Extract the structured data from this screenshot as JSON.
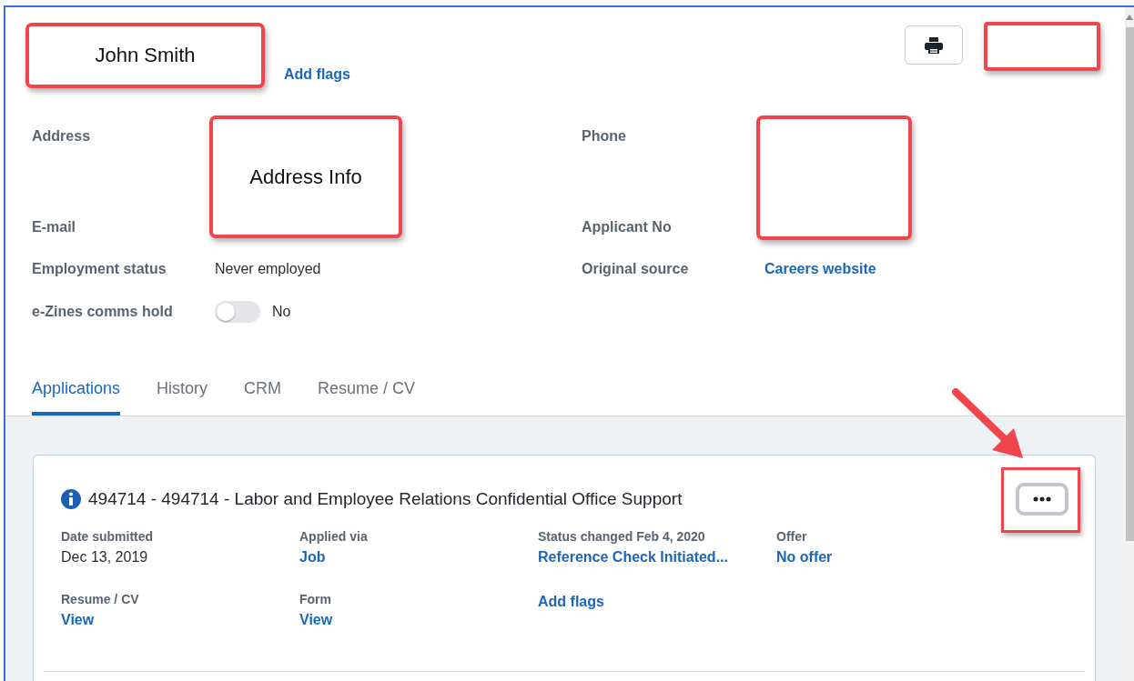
{
  "header": {
    "name": "John Smith",
    "add_flags": "Add flags"
  },
  "contact": {
    "address": {
      "label": "Address",
      "value": "Address Info"
    },
    "email": {
      "label": "E-mail"
    },
    "employment_status": {
      "label": "Employment status",
      "value": "Never employed"
    },
    "zines_hold": {
      "label": "e-Zines comms hold",
      "on": false,
      "value": "No"
    },
    "phone": {
      "label": "Phone"
    },
    "applicant_no": {
      "label": "Applicant No"
    },
    "original_source": {
      "label": "Original source",
      "value": "Careers website"
    }
  },
  "tabs": [
    {
      "label": "Applications",
      "selected": true
    },
    {
      "label": "History",
      "selected": false
    },
    {
      "label": "CRM",
      "selected": false
    },
    {
      "label": "Resume / CV",
      "selected": false
    }
  ],
  "application": {
    "title": "494714 - 494714 - Labor and Employee Relations Confidential Office Support",
    "menu_highlighted": true,
    "fields": [
      {
        "label": "Date submitted",
        "value": "Dec 13, 2019",
        "kind": "text"
      },
      {
        "label": "Applied via",
        "value": "Job",
        "kind": "link"
      },
      {
        "label": "Status changed Feb 4, 2020",
        "value": "Reference Check Initiated...",
        "kind": "link"
      },
      {
        "label": "Offer",
        "value": "No offer",
        "kind": "link"
      },
      {
        "label": "Resume / CV",
        "value": "View",
        "kind": "link"
      },
      {
        "label": "Form",
        "value": "View",
        "kind": "link"
      },
      {
        "value": "Add flags",
        "kind": "link"
      }
    ]
  }
}
